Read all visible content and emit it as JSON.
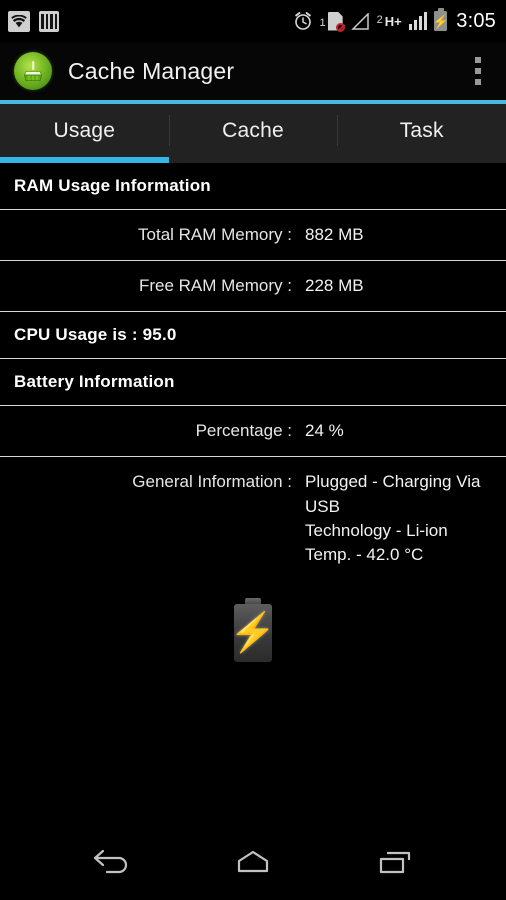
{
  "status_bar": {
    "wifi_icon": "wifi-icon",
    "bars_icon": "signal-bars-badge-icon",
    "alarm_icon": "alarm-clock-icon",
    "sim_slot_number": "1",
    "sim_icon": "sim-card-no-service-icon",
    "no_signal_icon": "no-signal-triangle-icon",
    "network_slot_number": "2",
    "network_type": "H+",
    "signal_icon": "signal-strength-icon",
    "battery_icon": "battery-charging-icon",
    "battery_glyph": "⚡",
    "clock": "3:05"
  },
  "action_bar": {
    "app_icon": "broom-app-icon",
    "title": "Cache Manager",
    "overflow_label": "more-options"
  },
  "accent_color": "#4ab8dd",
  "tab_indicator_color": "#33b5e5",
  "tabs": [
    {
      "label": "Usage",
      "active": true
    },
    {
      "label": "Cache",
      "active": false
    },
    {
      "label": "Task",
      "active": false
    }
  ],
  "content": {
    "ram_section_title": "RAM Usage Information",
    "total_ram_label": "Total RAM Memory :",
    "total_ram_value": "882 MB",
    "free_ram_label": "Free RAM Memory :",
    "free_ram_value": "228 MB",
    "cpu_usage_title": "CPU Usage is : 95.0",
    "battery_section_title": "Battery Information",
    "percentage_label": "Percentage :",
    "percentage_value": "24 %",
    "general_info_label": "General Information :",
    "general_info_value": "Plugged - Charging Via USB\nTechnology - Li-ion\nTemp. - 42.0 °C",
    "battery_figure_icon": "battery-charging-large-icon"
  },
  "nav_bar": {
    "back_label": "back-button",
    "home_label": "home-button",
    "recents_label": "recent-apps-button"
  }
}
